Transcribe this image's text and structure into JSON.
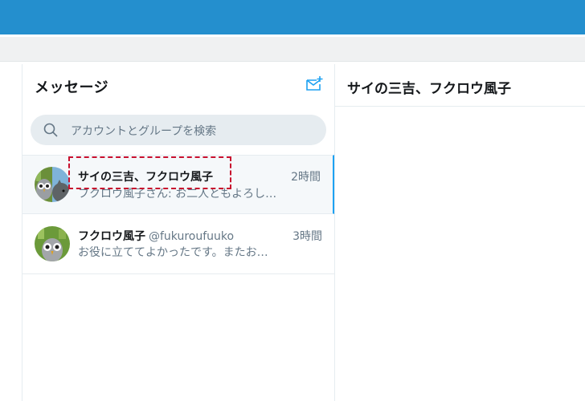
{
  "messages": {
    "title": "メッセージ",
    "compose_icon": "envelope-plus-icon",
    "search": {
      "placeholder": "アカウントとグループを検索",
      "icon": "search-icon"
    },
    "conversations": [
      {
        "name": "サイの三吉、フクロウ風子",
        "handle": "",
        "time": "2時間",
        "preview": "フクロウ風子さん: お二人ともよろし…",
        "selected": true,
        "avatar": "group-avatar-owl-and-rhino"
      },
      {
        "name": "フクロウ風子",
        "handle": "@fukuroufuuko",
        "time": "3時間",
        "preview": "お役に立ててよかったです。またお…",
        "selected": false,
        "avatar": "owl-avatar"
      }
    ]
  },
  "detail": {
    "title": "サイの三吉、フクロウ風子"
  },
  "colors": {
    "topbar": "#248fce",
    "accent": "#1da1f2",
    "highlight": "#c8102e"
  }
}
